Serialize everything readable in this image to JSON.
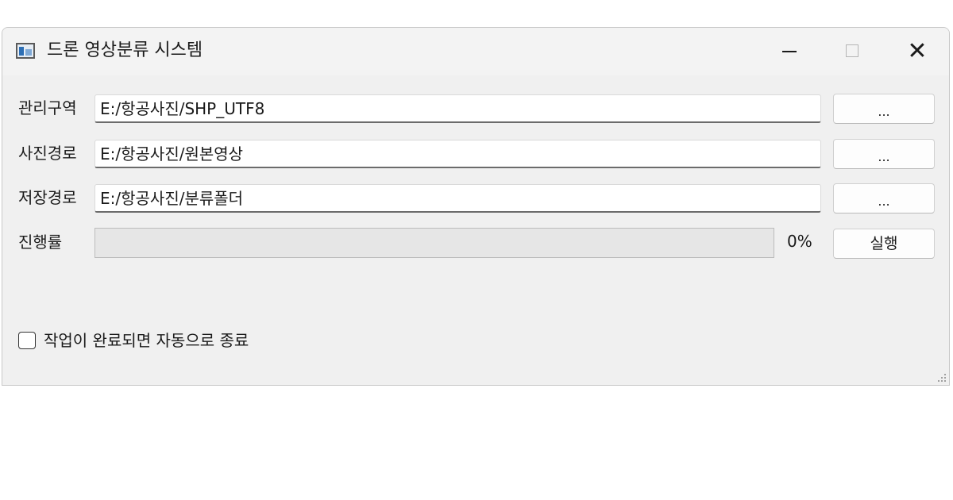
{
  "window": {
    "title": "드론 영상분류 시스템",
    "icon": "app-window-icon",
    "controls": {
      "minimize": "minimize-icon",
      "maximize": "maximize-icon",
      "close_glyph": "✕"
    }
  },
  "rows": [
    {
      "label": "관리구역",
      "value": "E:/항공사진/SHP_UTF8",
      "button": "..."
    },
    {
      "label": "사진경로",
      "value": "E:/항공사진/원본영상",
      "button": "..."
    },
    {
      "label": "저장경로",
      "value": "E:/항공사진/분류폴더",
      "button": "..."
    }
  ],
  "progress": {
    "label": "진행률",
    "percent": 0,
    "text": "0%",
    "run_button": "실행",
    "fill_color": "#06b025"
  },
  "auto_close": {
    "label": "작업이 완료되면 자동으로 종료",
    "checked": false
  }
}
